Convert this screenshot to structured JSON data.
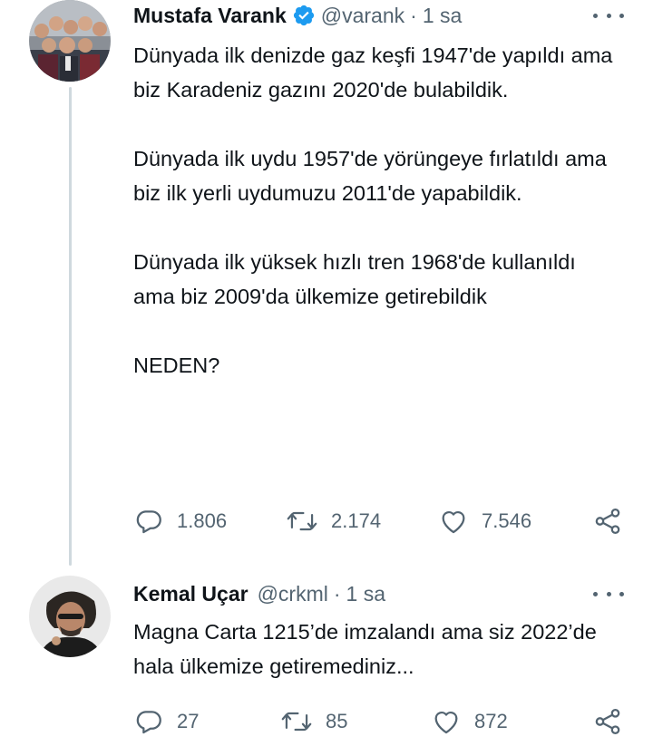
{
  "tweet": {
    "author_name": "Mustafa Varank",
    "handle": "@varank",
    "separator": "·",
    "time": "1 sa",
    "verified": true,
    "paragraphs": [
      "Dünyada ilk denizde gaz keşfi 1947'de yapıldı ama biz Karadeniz gazını 2020'de bulabildik.",
      "Dünyada ilk uydu 1957'de yörüngeye fırlatıldı ama biz ilk yerli uydumuzu 2011'de yapabildik.",
      "Dünyada ilk yüksek hızlı tren 1968'de kullanıldı ama biz 2009'da ülkemize getirebildik",
      "NEDEN?"
    ],
    "replies": "1.806",
    "retweets": "2.174",
    "likes": "7.546"
  },
  "reply": {
    "author_name": "Kemal Uçar",
    "handle": "@crkml",
    "separator": "·",
    "time": "1 sa",
    "paragraphs": [
      "Magna Carta 1215’de imzalandı ama siz 2022’de hala ülkemize getiremediniz..."
    ],
    "replies": "27",
    "retweets": "85",
    "likes": "872"
  },
  "icons": {
    "reply": "reply-bubble-icon",
    "retweet": "retweet-arrows-icon",
    "like": "heart-icon",
    "share": "share-icon",
    "more": "more-dots-icon",
    "verified": "verified-badge-icon"
  },
  "colors": {
    "text": "#0f1419",
    "secondary": "#536471",
    "verified": "#1d9bf0",
    "thread_line": "#cfd9de"
  }
}
